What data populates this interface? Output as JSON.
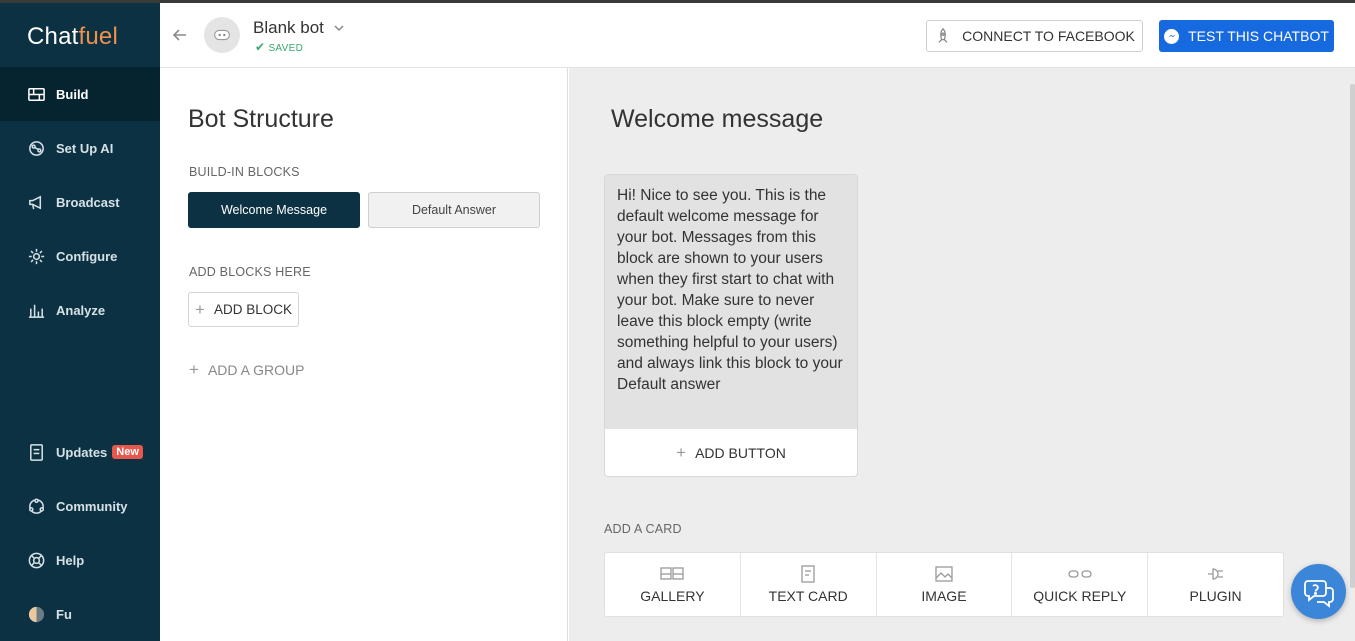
{
  "app": {
    "logo_chat": "Chat",
    "logo_fuel": "fuel"
  },
  "sidebar": {
    "items": [
      {
        "label": "Build",
        "icon": "build-icon"
      },
      {
        "label": "Set Up AI",
        "icon": "ai-icon"
      },
      {
        "label": "Broadcast",
        "icon": "megaphone-icon"
      },
      {
        "label": "Configure",
        "icon": "gear-icon"
      },
      {
        "label": "Analyze",
        "icon": "chart-icon"
      }
    ],
    "bottom": [
      {
        "label": "Updates",
        "icon": "updates-icon",
        "badge": "New"
      },
      {
        "label": "Community",
        "icon": "community-icon"
      },
      {
        "label": "Help",
        "icon": "help-icon"
      },
      {
        "label": "Fu",
        "icon": "avatar-icon"
      }
    ]
  },
  "header": {
    "bot_name": "Blank bot",
    "saved_status": "SAVED",
    "connect_label": "CONNECT TO FACEBOOK",
    "test_label": "TEST THIS CHATBOT"
  },
  "structure": {
    "title": "Bot Structure",
    "builtin_label": "BUILD-IN BLOCKS",
    "blocks": [
      "Welcome Message",
      "Default Answer"
    ],
    "add_blocks_label": "ADD BLOCKS HERE",
    "add_block_label": "ADD BLOCK",
    "add_group_label": "ADD A GROUP"
  },
  "editor": {
    "title": "Welcome message",
    "message_text": "Hi! Nice to see you. This is the default welcome message for your bot. Messages from this block are shown to your users when they first start to chat with your bot. Make sure to never leave this block empty (write something helpful to your users) and always link this block to your Default answer",
    "add_button_label": "ADD BUTTON",
    "add_card_label": "ADD A CARD",
    "cards": [
      "GALLERY",
      "TEXT CARD",
      "IMAGE",
      "QUICK REPLY",
      "PLUGIN"
    ]
  },
  "colors": {
    "sidebar_bg": "#0c3142",
    "accent_blue": "#1769e0",
    "logo_orange": "#f0904d",
    "badge_red": "#e8574c",
    "saved_green": "#3aa76d"
  }
}
